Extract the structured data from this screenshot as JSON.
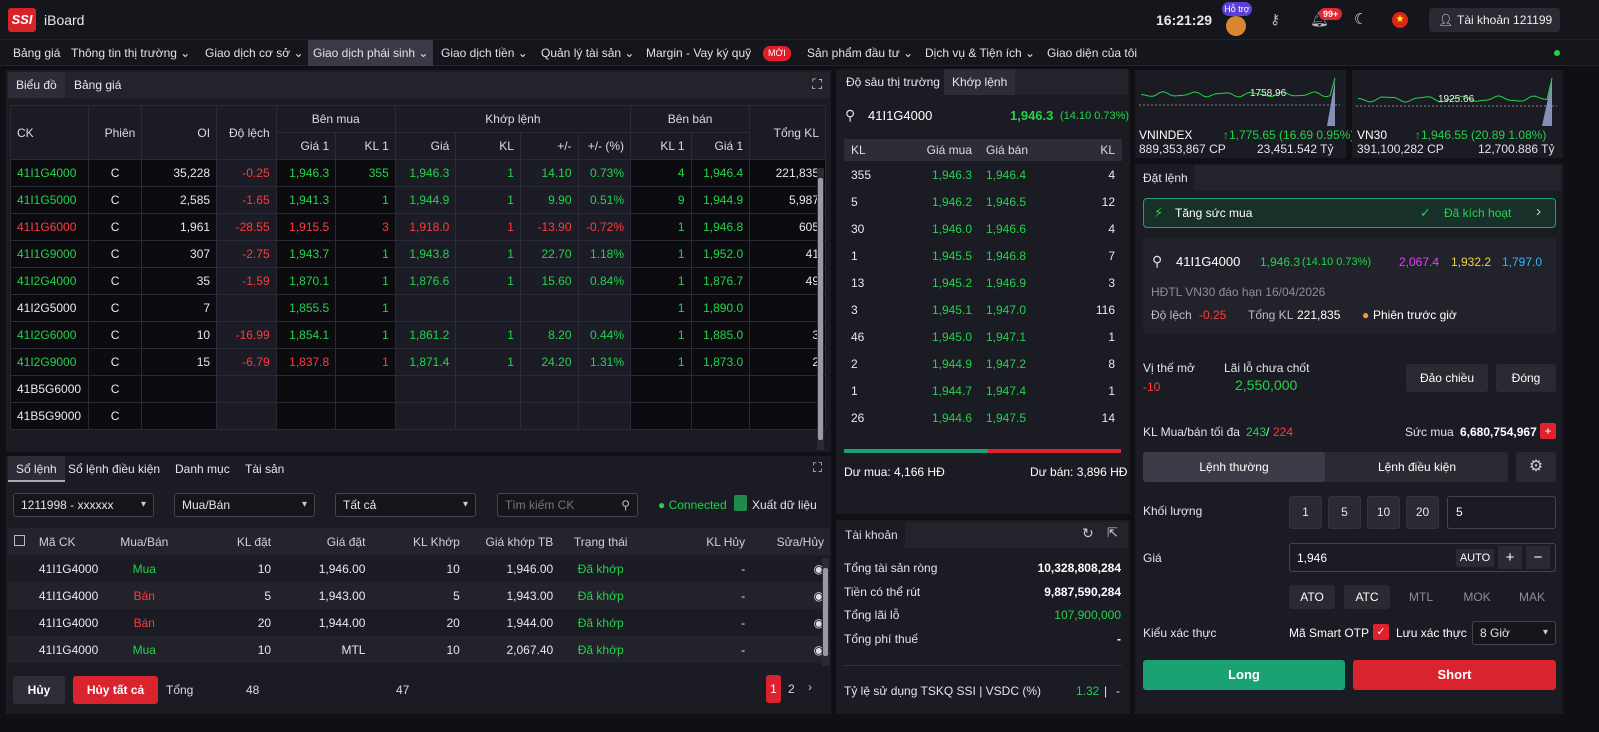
{
  "header": {
    "logo": "SSI",
    "app_name": "iBoard",
    "clock": "16:21:29",
    "support_badge": "Hỗ trợ",
    "notification_count": "99+",
    "account": "Tài khoản 121199"
  },
  "menu": [
    "Bảng giá",
    "Thông tin thị trường",
    "Giao dịch cơ sở",
    "Giao dịch phái sinh",
    "Giao dịch tiền",
    "Quản lý tài sản",
    "Margin - Vay ký quỹ",
    "Sản phẩm đầu tư",
    "Dịch vụ & Tiện ích",
    "Giao diện của tôi"
  ],
  "menu_new_badge": "MỚI",
  "board_tabs": [
    "Biểu đồ",
    "Bảng giá"
  ],
  "price_table": {
    "group_headers": {
      "buy": "Bên mua",
      "match": "Khớp lệnh",
      "sell": "Bên bán"
    },
    "headers": {
      "ck": "CK",
      "phien": "Phiên",
      "oi": "OI",
      "dolech": "Độ lệch",
      "gia1": "Giá 1",
      "kl1": "KL 1",
      "gia": "Giá",
      "kl": "KL",
      "change": "+/-",
      "pct": "+/- (%)",
      "tongkl": "Tổng KL"
    },
    "rows": [
      {
        "ck": "41I1G4000",
        "ckc": "green",
        "phien": "C",
        "oi": "35,228",
        "dolech": "-0.25",
        "b_gia": "1,946.3",
        "b_gc": "green",
        "b_kl": "355",
        "b_kc": "green",
        "m_gia": "1,946.3",
        "m_gc": "green",
        "m_kl": "1",
        "m_ch": "14.10",
        "m_pct": "0.73%",
        "m_cc": "green",
        "s_kl": "4",
        "s_gia": "1,946.4",
        "s_c": "green",
        "tong": "221,835"
      },
      {
        "ck": "41I1G5000",
        "ckc": "green",
        "phien": "C",
        "oi": "2,585",
        "dolech": "-1.65",
        "b_gia": "1,941.3",
        "b_gc": "green",
        "b_kl": "1",
        "b_kc": "green",
        "m_gia": "1,944.9",
        "m_gc": "green",
        "m_kl": "1",
        "m_ch": "9.90",
        "m_pct": "0.51%",
        "m_cc": "green",
        "s_kl": "9",
        "s_gia": "1,944.9",
        "s_c": "green",
        "tong": "5,987"
      },
      {
        "ck": "41I1G6000",
        "ckc": "red",
        "phien": "C",
        "oi": "1,961",
        "dolech": "-28.55",
        "b_gia": "1,915.5",
        "b_gc": "red",
        "b_kl": "3",
        "b_kc": "red",
        "m_gia": "1,918.0",
        "m_gc": "red",
        "m_kl": "1",
        "m_ch": "-13.90",
        "m_pct": "-0.72%",
        "m_cc": "red",
        "s_kl": "1",
        "s_gia": "1,946.8",
        "s_c": "green",
        "tong": "605"
      },
      {
        "ck": "41I1G9000",
        "ckc": "green",
        "phien": "C",
        "oi": "307",
        "dolech": "-2.75",
        "b_gia": "1,943.7",
        "b_gc": "green",
        "b_kl": "1",
        "b_kc": "green",
        "m_gia": "1,943.8",
        "m_gc": "green",
        "m_kl": "1",
        "m_ch": "22.70",
        "m_pct": "1.18%",
        "m_cc": "green",
        "s_kl": "1",
        "s_gia": "1,952.0",
        "s_c": "green",
        "tong": "41"
      },
      {
        "ck": "41I2G4000",
        "ckc": "green",
        "phien": "C",
        "oi": "35",
        "dolech": "-1.59",
        "b_gia": "1,870.1",
        "b_gc": "green",
        "b_kl": "1",
        "b_kc": "green",
        "m_gia": "1,876.6",
        "m_gc": "green",
        "m_kl": "1",
        "m_ch": "15.60",
        "m_pct": "0.84%",
        "m_cc": "green",
        "s_kl": "1",
        "s_gia": "1,876.7",
        "s_c": "green",
        "tong": "49"
      },
      {
        "ck": "41I2G5000",
        "ckc": "white",
        "phien": "C",
        "oi": "7",
        "dolech": "",
        "b_gia": "1,855.5",
        "b_gc": "green",
        "b_kl": "1",
        "b_kc": "green",
        "m_gia": "",
        "m_gc": "green",
        "m_kl": "",
        "m_ch": "",
        "m_pct": "",
        "m_cc": "green",
        "s_kl": "1",
        "s_gia": "1,890.0",
        "s_c": "green",
        "tong": ""
      },
      {
        "ck": "41I2G6000",
        "ckc": "green",
        "phien": "C",
        "oi": "10",
        "dolech": "-16.99",
        "b_gia": "1,854.1",
        "b_gc": "green",
        "b_kl": "1",
        "b_kc": "green",
        "m_gia": "1,861.2",
        "m_gc": "green",
        "m_kl": "1",
        "m_ch": "8.20",
        "m_pct": "0.44%",
        "m_cc": "green",
        "s_kl": "1",
        "s_gia": "1,885.0",
        "s_c": "green",
        "tong": "3"
      },
      {
        "ck": "41I2G9000",
        "ckc": "green",
        "phien": "C",
        "oi": "15",
        "dolech": "-6.79",
        "b_gia": "1,837.8",
        "b_gc": "red",
        "b_kl": "1",
        "b_kc": "red",
        "m_gia": "1,871.4",
        "m_gc": "green",
        "m_kl": "1",
        "m_ch": "24.20",
        "m_pct": "1.31%",
        "m_cc": "green",
        "s_kl": "1",
        "s_gia": "1,873.0",
        "s_c": "green",
        "tong": "2"
      },
      {
        "ck": "41B5G6000",
        "ckc": "white",
        "phien": "C",
        "oi": "",
        "dolech": "",
        "b_gia": "",
        "b_gc": "green",
        "b_kl": "",
        "b_kc": "green",
        "m_gia": "",
        "m_gc": "green",
        "m_kl": "",
        "m_ch": "",
        "m_pct": "",
        "m_cc": "green",
        "s_kl": "",
        "s_gia": "",
        "s_c": "green",
        "tong": ""
      },
      {
        "ck": "41B5G9000",
        "ckc": "white",
        "phien": "C",
        "oi": "",
        "dolech": "",
        "b_gia": "",
        "b_gc": "green",
        "b_kl": "",
        "b_kc": "green",
        "m_gia": "",
        "m_gc": "green",
        "m_kl": "",
        "m_ch": "",
        "m_pct": "",
        "m_cc": "green",
        "s_kl": "",
        "s_gia": "",
        "s_c": "green",
        "tong": ""
      }
    ]
  },
  "order_tabs": [
    "Sổ lệnh",
    "Sổ lệnh điều kiện",
    "Danh mục",
    "Tài sản"
  ],
  "order_filters": {
    "account": "1211998 - xxxxxx",
    "side": "Mua/Bán",
    "status": "Tất cả",
    "search_placeholder": "Tìm kiếm CK",
    "connected": "Connected",
    "export": "Xuất dữ liệu"
  },
  "order_table": {
    "headers": [
      "Mã CK",
      "Mua/Bán",
      "KL đặt",
      "Giá đặt",
      "KL Khớp",
      "Giá khớp TB",
      "Trạng thái",
      "KL Hủy",
      "Sửa/Hủy"
    ],
    "rows": [
      {
        "ma": "41I1G4000",
        "side": "Mua",
        "sc": "green",
        "kl": "10",
        "gia": "1,946.00",
        "klk": "10",
        "gkt": "1,946.00",
        "tt": "Đã khớp",
        "huy": "-"
      },
      {
        "ma": "41I1G4000",
        "side": "Bán",
        "sc": "red",
        "kl": "5",
        "gia": "1,943.00",
        "klk": "5",
        "gkt": "1,943.00",
        "tt": "Đã khớp",
        "huy": "-"
      },
      {
        "ma": "41I1G4000",
        "side": "Bán",
        "sc": "red",
        "kl": "20",
        "gia": "1,944.00",
        "klk": "20",
        "gkt": "1,944.00",
        "tt": "Đã khớp",
        "huy": "-"
      },
      {
        "ma": "41I1G4000",
        "side": "Mua",
        "sc": "green",
        "kl": "10",
        "gia": "MTL",
        "klk": "10",
        "gkt": "2,067.40",
        "tt": "Đã khớp",
        "huy": "-"
      }
    ],
    "footer": {
      "cancel": "Hủy",
      "cancel_all": "Hủy tất cả",
      "total_label": "Tổng",
      "total_kl": "48",
      "total_klk": "47",
      "pages": [
        "1",
        "2"
      ]
    }
  },
  "depth": {
    "tabs": [
      "Độ sâu thị trường",
      "Khớp lệnh"
    ],
    "symbol": "41I1G4000",
    "price": "1,946.3",
    "change": "(14.10 0.73%)",
    "headers": [
      "KL",
      "Giá mua",
      "Giá bán",
      "KL"
    ],
    "rows": [
      {
        "bkl": "355",
        "bg": "1,946.3",
        "sg": "1,946.4",
        "skl": "4"
      },
      {
        "bkl": "5",
        "bg": "1,946.2",
        "sg": "1,946.5",
        "skl": "12"
      },
      {
        "bkl": "30",
        "bg": "1,946.0",
        "sg": "1,946.6",
        "skl": "4"
      },
      {
        "bkl": "1",
        "bg": "1,945.5",
        "sg": "1,946.8",
        "skl": "7"
      },
      {
        "bkl": "13",
        "bg": "1,945.2",
        "sg": "1,946.9",
        "skl": "3"
      },
      {
        "bkl": "3",
        "bg": "1,945.1",
        "sg": "1,947.0",
        "skl": "116"
      },
      {
        "bkl": "46",
        "bg": "1,945.0",
        "sg": "1,947.1",
        "skl": "1"
      },
      {
        "bkl": "2",
        "bg": "1,944.9",
        "sg": "1,947.2",
        "skl": "8"
      },
      {
        "bkl": "1",
        "bg": "1,944.7",
        "sg": "1,947.4",
        "skl": "1"
      },
      {
        "bkl": "26",
        "bg": "1,944.6",
        "sg": "1,947.5",
        "skl": "14"
      }
    ],
    "buy_ratio": 0.52,
    "du_mua": "Dư mua: 4,166 HĐ",
    "du_ban": "Dư bán: 3,896 HĐ"
  },
  "account_panel": {
    "title": "Tài khoản",
    "rows": [
      {
        "k": "Tổng tài sản ròng",
        "v": "10,328,808,284",
        "c": "white"
      },
      {
        "k": "Tiền có thể rút",
        "v": "9,887,590,284",
        "c": "white"
      },
      {
        "k": "Tổng lãi lỗ",
        "v": "107,900,000",
        "c": "green"
      },
      {
        "k": "Tổng phí thuế",
        "v": "-",
        "c": "white"
      }
    ],
    "ratio_label": "Tỷ lệ sử dụng TSKQ SSI | VSDC (%)",
    "ratio_val": "1.32",
    "ratio_sep": "-"
  },
  "indices": [
    {
      "name": "VNINDEX",
      "value": "1,775.65 (16.69 0.95%)",
      "vol": "889,353,867 CP",
      "val": "23,451.542 Tỷ",
      "ref": "1758.96"
    },
    {
      "name": "VN30",
      "value": "1,946.55 (20.89 1.08%)",
      "vol": "391,100,282 CP",
      "val": "12,700.886 Tỷ",
      "ref": "1925.66"
    }
  ],
  "order_entry": {
    "title": "Đặt lệnh",
    "boost": "Tăng sức mua",
    "boost_status": "Đã kích hoạt",
    "symbol": "41I1G4000",
    "price": "1,946.3",
    "change": "(14.10 0.73%)",
    "ceil": "2,067.4",
    "ref": "1,932.2",
    "floor": "1,797.0",
    "desc": "HĐTL VN30 đáo hạn 16/04/2026",
    "dolech_label": "Độ lệch",
    "dolech": "-0.25",
    "tongkl_label": "Tổng KL",
    "tongkl": "221,835",
    "session": "Phiên trước giờ",
    "vithe_label": "Vị thế mở",
    "vithe": "-10",
    "laiLo_label": "Lãi lỗ chưa chốt",
    "laiLo": "2,550,000",
    "reverse": "Đảo chiều",
    "close": "Đóng",
    "maxkl_label": "KL Mua/bán tối đa",
    "max_buy": "243",
    "max_sell": "224",
    "suc_mua_label": "Sức mua",
    "suc_mua": "6,680,754,967",
    "order_type_tabs": [
      "Lệnh thường",
      "Lệnh điều kiện"
    ],
    "qty_label": "Khối lượng",
    "qty_presets": [
      "1",
      "5",
      "10",
      "20"
    ],
    "qty": "5",
    "price_label": "Giá",
    "price_input": "1,946",
    "auto": "AUTO",
    "price_types": [
      "ATO",
      "ATC",
      "MTL",
      "MOK",
      "MAK"
    ],
    "auth_label": "Kiểu xác thực",
    "auth_method": "Mã Smart OTP",
    "save_auth": "Lưu xác thực",
    "save_time": "8 Giờ",
    "long": "Long",
    "short": "Short"
  },
  "colors": {
    "green": "#22d34a",
    "red": "#ff3b3b",
    "long": "#1aa274",
    "short": "#d9232f",
    "brand": "#d6232a"
  }
}
